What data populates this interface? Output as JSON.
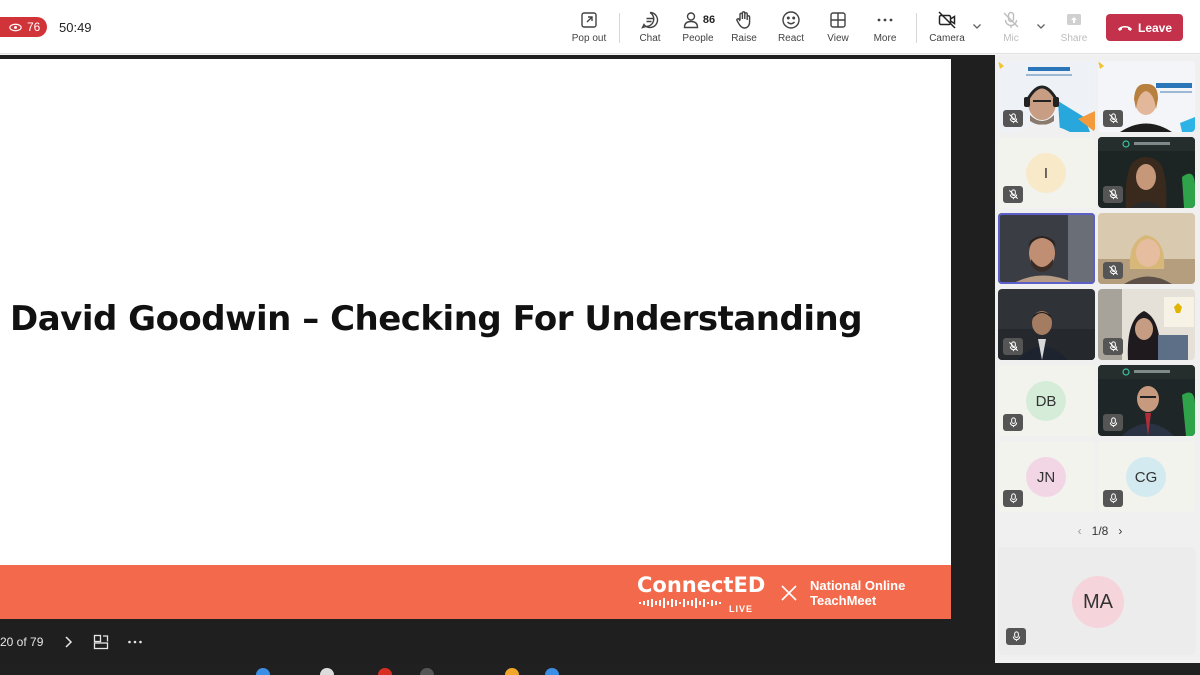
{
  "header": {
    "live_count": "76",
    "timer": "50:49",
    "buttons": [
      {
        "id": "popout",
        "label": "Pop out",
        "icon": "pop-out-icon"
      },
      {
        "id": "chat",
        "label": "Chat",
        "icon": "chat-icon"
      },
      {
        "id": "people",
        "label": "People",
        "icon": "people-icon",
        "count": "86"
      },
      {
        "id": "raise",
        "label": "Raise",
        "icon": "raise-hand-icon"
      },
      {
        "id": "react",
        "label": "React",
        "icon": "smiley-icon"
      },
      {
        "id": "view",
        "label": "View",
        "icon": "grid-icon"
      },
      {
        "id": "more",
        "label": "More",
        "icon": "more-icon"
      },
      {
        "id": "camera",
        "label": "Camera",
        "icon": "camera-off-icon"
      },
      {
        "id": "mic",
        "label": "Mic",
        "icon": "mic-icon"
      },
      {
        "id": "share",
        "label": "Share",
        "icon": "share-icon"
      }
    ],
    "leave_label": "Leave",
    "leave_color": "#c4314b"
  },
  "slide": {
    "title": "David Goodwin – Checking For Understanding",
    "brand": "ConnectED",
    "brand_live": "LIVE",
    "band_text_line1": "National Online",
    "band_text_line2": "TeachMeet",
    "band_color": "#f26a4b",
    "page_indicator": "20 of 79"
  },
  "participants": {
    "tiles": [
      {
        "type": "video",
        "desc": "man-with-headset"
      },
      {
        "type": "video",
        "desc": "woman-presenter"
      },
      {
        "type": "avatar",
        "initials": "I",
        "bg": "#f8e9c9"
      },
      {
        "type": "video",
        "desc": "woman-curly-hair"
      },
      {
        "type": "video",
        "desc": "man-beard",
        "active": true
      },
      {
        "type": "video",
        "desc": "woman-blonde"
      },
      {
        "type": "video",
        "desc": "man-suit"
      },
      {
        "type": "video",
        "desc": "woman-headscarf"
      },
      {
        "type": "avatar",
        "initials": "DB",
        "bg": "#d5ecd8"
      },
      {
        "type": "video",
        "desc": "man-glasses"
      },
      {
        "type": "avatar",
        "initials": "JN",
        "bg": "#f2d6e6"
      },
      {
        "type": "avatar",
        "initials": "CG",
        "bg": "#d3eaf0"
      }
    ],
    "page": "1/8",
    "spotlight_initials": "MA"
  },
  "colors": {
    "accent": "#5b5fc7",
    "live_red": "#d13438"
  }
}
